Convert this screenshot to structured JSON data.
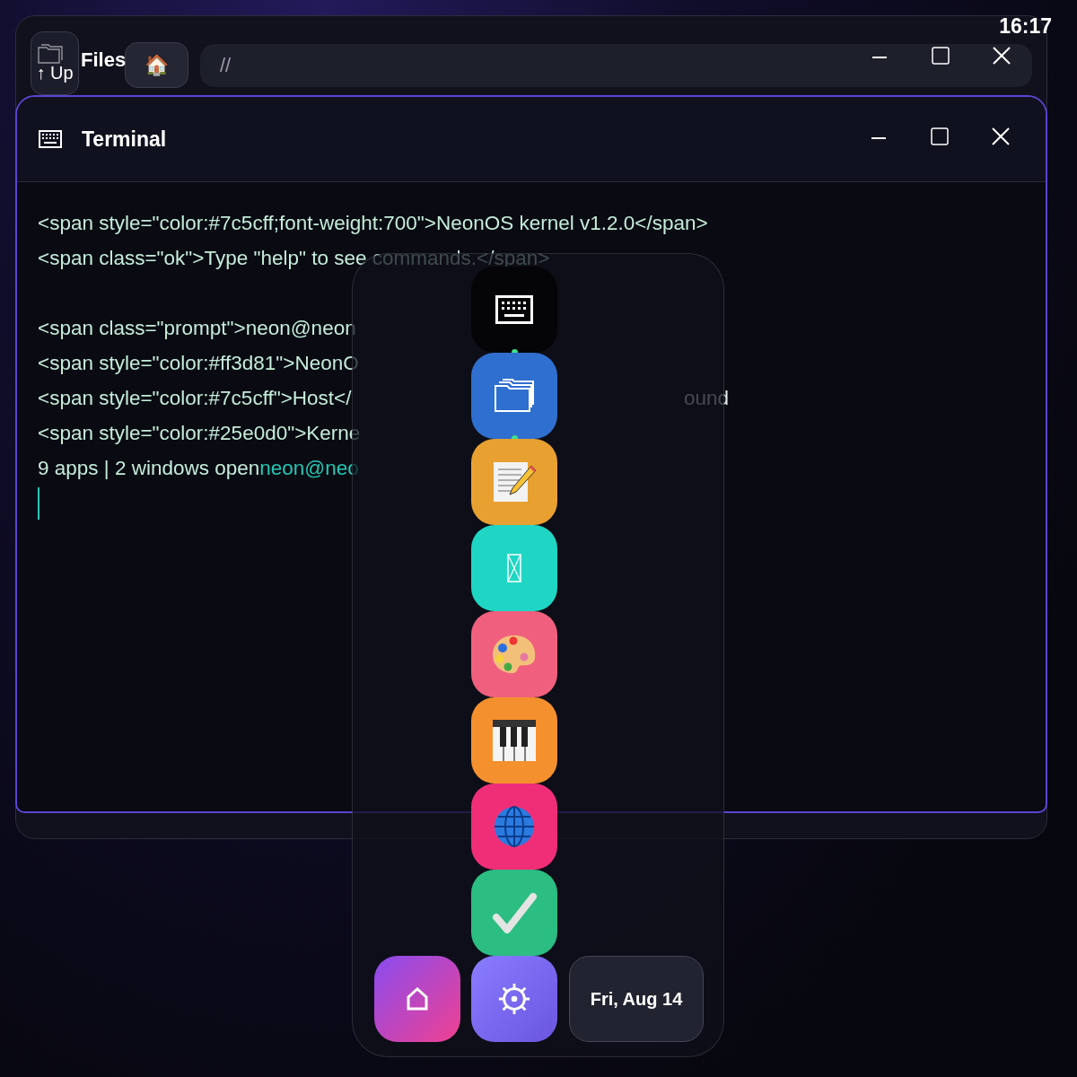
{
  "clock": "16:17",
  "files_window": {
    "title": "Files",
    "up_button": "↑ Up",
    "home_button": "🏠",
    "path": "//"
  },
  "terminal_window": {
    "title": "Terminal",
    "lines": [
      {
        "kind": "text",
        "segments": [
          {
            "text": "<span style=\"color:#7c5cff;font-weight:700\">NeonOS kernel v1.2.0</span>",
            "kind": "plain"
          }
        ]
      },
      {
        "kind": "text",
        "segments": [
          {
            "text": "<span class=\"ok\">Type \"help\" to see commands.</span>",
            "kind": "plain"
          }
        ]
      },
      {
        "kind": "blank"
      },
      {
        "kind": "text",
        "segments": [
          {
            "text": "<span class=\"prompt\">neon@neon",
            "kind": "plain"
          }
        ]
      },
      {
        "kind": "text",
        "segments": [
          {
            "text": "<span style=\"color:#ff3d81\">NeonO",
            "kind": "plain"
          }
        ]
      },
      {
        "kind": "text",
        "segments": [
          {
            "text": "<span style=\"color:#7c5cff\">Host</",
            "kind": "plain"
          },
          {
            "text": "ound",
            "kind": "fragment"
          }
        ]
      },
      {
        "kind": "text",
        "segments": [
          {
            "text": "<span style=\"color:#25e0d0\">Kerne",
            "kind": "plain"
          }
        ]
      },
      {
        "kind": "text",
        "segments": [
          {
            "text": "9 apps | 2 windows open",
            "kind": "plain"
          },
          {
            "text": "neon@neo",
            "kind": "accent"
          }
        ]
      },
      {
        "kind": "cursor"
      }
    ]
  },
  "dock": {
    "apps": [
      {
        "kind": "keyboard",
        "color": "#050507",
        "running": true
      },
      {
        "kind": "folders",
        "color": "#2f6fd0",
        "running": true
      },
      {
        "kind": "notepad",
        "color": "#e8a030",
        "running": false
      },
      {
        "kind": "glyph",
        "color": "#1fd6c4",
        "running": false
      },
      {
        "kind": "palette",
        "color": "#f0607e",
        "running": false
      },
      {
        "kind": "piano",
        "color": "#f5902e",
        "running": false
      },
      {
        "kind": "globe",
        "color": "#f02e78",
        "running": false
      },
      {
        "kind": "check",
        "color": "#2cbd82",
        "running": false
      }
    ],
    "date": "Fri, Aug 14"
  }
}
